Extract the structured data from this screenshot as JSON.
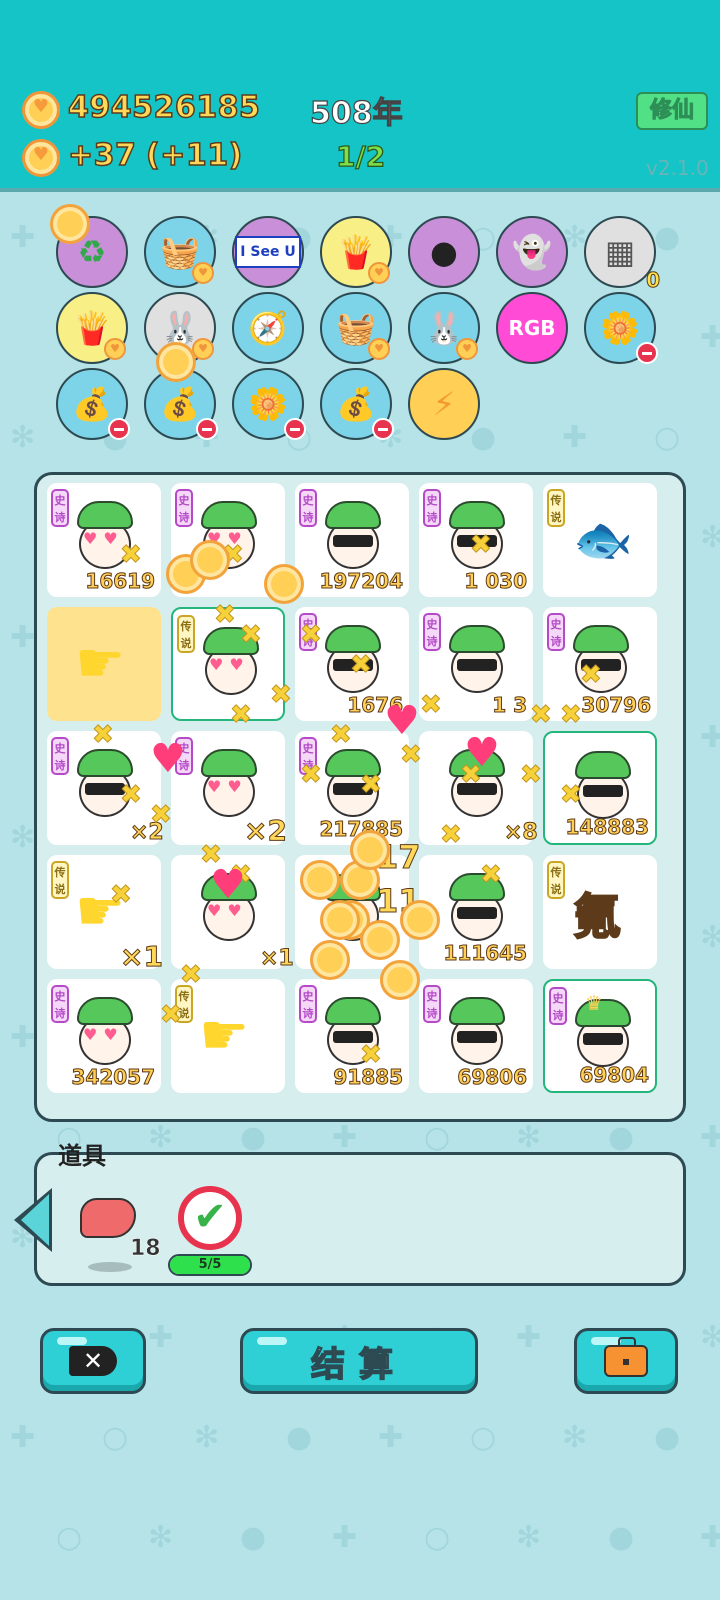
{
  "header": {
    "coins_total": "494526185",
    "coins_rate": "+37",
    "coins_bonus": "(+11)",
    "year": "508年",
    "wave": "1/2",
    "cultivate_label": "修仙",
    "version": "v2.1.0"
  },
  "relics": [
    {
      "icon": "recycle-icon",
      "glyph": "♻",
      "bg": "#c98fd8",
      "fg": "#31a84a"
    },
    {
      "icon": "fruit-basket-icon",
      "glyph": "🧺",
      "bg": "#7dd3e8",
      "fg": "#b2713a"
    },
    {
      "icon": "i-see-u-sign-icon",
      "glyph": "I See U",
      "bg": "#c98fd8",
      "fg": "#1d3fc0"
    },
    {
      "icon": "fries-icon",
      "glyph": "🍟",
      "bg": "#f8ef86",
      "fg": "#e23d3d"
    },
    {
      "icon": "eyepatch-icon",
      "glyph": "●",
      "bg": "#c98fd8",
      "fg": "#222"
    },
    {
      "icon": "ghost-icon",
      "glyph": "👻",
      "bg": "#c98fd8",
      "fg": "#f3c024"
    },
    {
      "icon": "egg-tray-icon",
      "glyph": "▦",
      "bg": "#e0e0e0",
      "fg": "#555",
      "count": "0"
    },
    {
      "icon": "fries-icon",
      "glyph": "🍟",
      "bg": "#f8ef86",
      "fg": "#e23d3d"
    },
    {
      "icon": "rabbit-icon",
      "glyph": "🐰",
      "bg": "#e0e0e0",
      "fg": "#fff"
    },
    {
      "icon": "compass-icon",
      "glyph": "🧭",
      "bg": "#7dd3e8",
      "fg": "#e23d3d"
    },
    {
      "icon": "fruit-basket-icon",
      "glyph": "🧺",
      "bg": "#7dd3e8",
      "fg": "#b2713a"
    },
    {
      "icon": "rabbit-icon",
      "glyph": "🐰",
      "bg": "#7dd3e8",
      "fg": "#fff"
    },
    {
      "icon": "rgb-icon",
      "glyph": "RGB",
      "bg": "#ff4bd6",
      "fg": "#fff"
    },
    {
      "icon": "potted-flower-icon",
      "glyph": "🌼",
      "bg": "#7dd3e8",
      "fg": "#fff"
    },
    {
      "icon": "money-sack-icon",
      "glyph": "💰",
      "bg": "#7dd3e8",
      "fg": "#7a8f5c"
    },
    {
      "icon": "money-sack-icon",
      "glyph": "💰",
      "bg": "#7dd3e8",
      "fg": "#7a8f5c"
    },
    {
      "icon": "potted-flower-icon",
      "glyph": "🌼",
      "bg": "#7dd3e8",
      "fg": "#fff"
    },
    {
      "icon": "money-sack-icon",
      "glyph": "💰",
      "bg": "#7dd3e8",
      "fg": "#7a8f5c"
    },
    {
      "icon": "lightning-icon",
      "glyph": "⚡",
      "bg": "#ffcf56",
      "fg": "#f39a2c"
    }
  ],
  "grid": {
    "cells": [
      {
        "kind": "face",
        "tag": "史诗",
        "tagType": "epic",
        "eyes": "hearts",
        "score": "16619"
      },
      {
        "kind": "face",
        "tag": "史诗",
        "tagType": "epic",
        "eyes": "hearts",
        "score": ""
      },
      {
        "kind": "face",
        "tag": "史诗",
        "tagType": "epic",
        "eyes": "glasses",
        "score": "197204"
      },
      {
        "kind": "face",
        "tag": "史诗",
        "tagType": "epic",
        "eyes": "glasses",
        "score": "1 030"
      },
      {
        "kind": "fish",
        "tag": "传说",
        "tagType": "legend",
        "score": ""
      },
      {
        "kind": "hand",
        "tag": "",
        "tagType": "",
        "score": "",
        "highlight": true
      },
      {
        "kind": "face",
        "tag": "传说",
        "tagType": "legend",
        "eyes": "hearts",
        "score": "",
        "green": true
      },
      {
        "kind": "face",
        "tag": "史诗",
        "tagType": "epic",
        "eyes": "glasses",
        "score": "1676"
      },
      {
        "kind": "face",
        "tag": "史诗",
        "tagType": "epic",
        "eyes": "glasses",
        "score": "1 3"
      },
      {
        "kind": "face",
        "tag": "史诗",
        "tagType": "epic",
        "eyes": "glasses",
        "score": "30796"
      },
      {
        "kind": "face",
        "tag": "史诗",
        "tagType": "epic",
        "eyes": "glasses",
        "score": ""
      },
      {
        "kind": "face",
        "tag": "史诗",
        "tagType": "epic",
        "eyes": "hearts",
        "score": ""
      },
      {
        "kind": "face",
        "tag": "史诗",
        "tagType": "epic",
        "eyes": "glasses",
        "score": "217885"
      },
      {
        "kind": "face",
        "tag": "",
        "tagType": "",
        "eyes": "glasses",
        "score": ""
      },
      {
        "kind": "face",
        "tag": "",
        "tagType": "",
        "eyes": "glasses",
        "score": "148883",
        "green": true
      },
      {
        "kind": "hand",
        "tag": "传说",
        "tagType": "legend",
        "score": ""
      },
      {
        "kind": "face",
        "tag": "",
        "tagType": "",
        "eyes": "hearts",
        "score": ""
      },
      {
        "kind": "face",
        "tag": "",
        "tagType": "",
        "eyes": "hearts",
        "score": ""
      },
      {
        "kind": "face",
        "tag": "",
        "tagType": "",
        "eyes": "glasses",
        "score": "111645"
      },
      {
        "kind": "element",
        "tag": "传说",
        "tagType": "legend",
        "glyph": "氪",
        "score": ""
      },
      {
        "kind": "face",
        "tag": "史诗",
        "tagType": "epic",
        "eyes": "hearts",
        "score": "342057"
      },
      {
        "kind": "hand",
        "tag": "传说",
        "tagType": "legend",
        "score": ""
      },
      {
        "kind": "face",
        "tag": "史诗",
        "tagType": "epic",
        "eyes": "glasses",
        "score": "91885"
      },
      {
        "kind": "face",
        "tag": "史诗",
        "tagType": "epic",
        "eyes": "glasses",
        "score": "69806"
      },
      {
        "kind": "face",
        "tag": "史诗",
        "tagType": "epic",
        "eyes": "glasses",
        "score": "69804",
        "green": true,
        "crown": true
      }
    ]
  },
  "multipliers": [
    {
      "text": "×2"
    },
    {
      "text": "×2"
    },
    {
      "text": "×8"
    },
    {
      "text": "×1"
    },
    {
      "text": "×1"
    },
    {
      "text": "17"
    },
    {
      "text": "11"
    }
  ],
  "items": {
    "title": "道具",
    "liver_count": "18",
    "check_progress_label": "5/5",
    "check_progress": 1.0
  },
  "buttons": {
    "settle_label": "结算"
  },
  "colors": {
    "header_bg": "#14c4c6",
    "page_bg": "#b5e3e8",
    "coin_gold": "#ffcf56",
    "accent_button": "#2ed0d5"
  }
}
